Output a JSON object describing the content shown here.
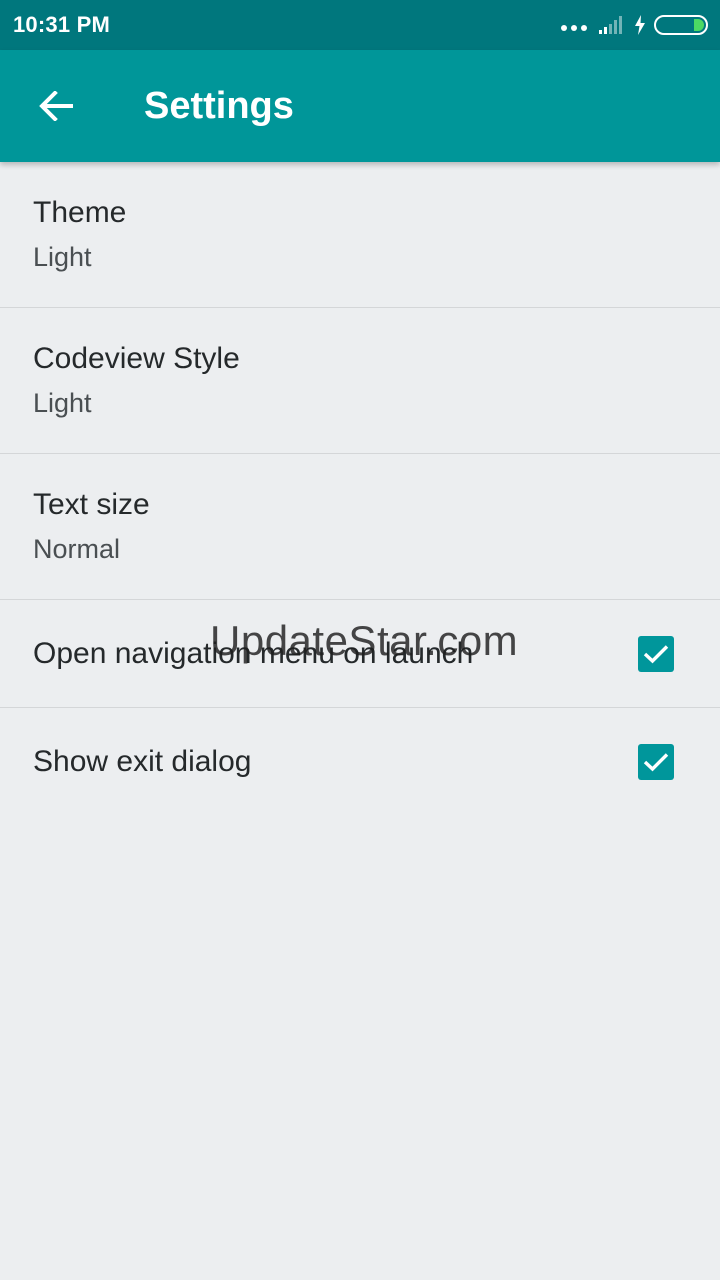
{
  "status_bar": {
    "time": "10:31 PM",
    "icons": [
      "more-dots-icon",
      "signal-icon",
      "charging-bolt-icon",
      "battery-icon"
    ]
  },
  "app_bar": {
    "title": "Settings",
    "back_icon": "arrow-back-icon",
    "color": "#009699"
  },
  "settings": {
    "theme": {
      "label": "Theme",
      "value": "Light"
    },
    "codeview_style": {
      "label": "Codeview Style",
      "value": "Light"
    },
    "text_size": {
      "label": "Text size",
      "value": "Normal"
    },
    "open_nav_menu": {
      "label": "Open navigation menu on launch",
      "checked": true
    },
    "show_exit_dialog": {
      "label": "Show exit dialog",
      "checked": true
    }
  },
  "watermark": "UpdateStar.com",
  "colors": {
    "status_bar": "#00777d",
    "accent": "#00969b",
    "background": "#eceef0"
  }
}
